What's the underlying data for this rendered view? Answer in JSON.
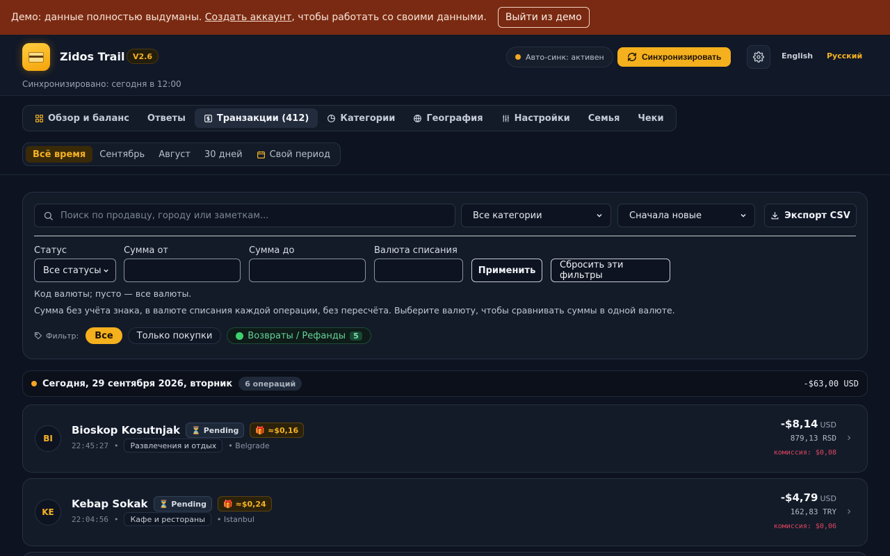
{
  "banner": {
    "text_before": "Демо: данные полностью выдуманы. ",
    "link": "Создать аккаунт",
    "text_after": ", чтобы работать со своими данными.",
    "exit_button": "Выйти из демо"
  },
  "header": {
    "app_name": "Zidos Trail",
    "version": "V2.6",
    "synced": "Синхронизировано: сегодня в 12:00",
    "autosync": "Авто-синк: активен",
    "sync_button": "Синхронизировать",
    "lang_en": "English",
    "lang_ru": "Русский",
    "accent_color": "#f5b01e"
  },
  "tabs": [
    {
      "label": "Обзор и баланс",
      "icon": "grid-icon"
    },
    {
      "label": "Ответы",
      "icon": ""
    },
    {
      "label": "Транзакции (412)",
      "icon": "dollar-icon",
      "active": true
    },
    {
      "label": "Категории",
      "icon": "pie-icon"
    },
    {
      "label": "География",
      "icon": "globe-icon"
    },
    {
      "label": "Настройки",
      "icon": "sliders-icon"
    },
    {
      "label": "Семья",
      "icon": ""
    },
    {
      "label": "Чеки",
      "icon": ""
    }
  ],
  "periods": [
    {
      "label": "Всё время",
      "active": true
    },
    {
      "label": "Сентябрь"
    },
    {
      "label": "Август"
    },
    {
      "label": "30 дней"
    },
    {
      "label": "Свой период",
      "icon": "calendar-icon"
    }
  ],
  "filters": {
    "search_placeholder": "Поиск по продавцу, городу или заметкам...",
    "category_select": "Все категории",
    "sort_select": "Сначала новые",
    "export": "Экспорт CSV",
    "status_label": "Статус",
    "status_value": "Все статусы",
    "amount_from_label": "Сумма от",
    "amount_to_label": "Сумма до",
    "currency_label": "Валюта списания",
    "apply": "Применить",
    "reset": "Сбросить эти фильтры",
    "hint_currency": "Код валюты; пусто — все валюты.",
    "hint_amount": "Сумма без учёта знака, в валюте списания каждой операции, без пересчёта. Выберите валюту, чтобы сравнивать суммы в одной валюте.",
    "filter_label": "Фильтр:",
    "chip_all": "Все",
    "chip_purchases": "Только покупки",
    "chip_refunds": "Возвраты / Рефанды",
    "chip_refunds_count": "5"
  },
  "day": {
    "title": "Сегодня, 29 сентября 2026, вторник",
    "count": "6 операций",
    "total": "-$63,00 USD"
  },
  "transactions": [
    {
      "initials": "BI",
      "merchant": "Bioskop Kosutnjak",
      "status": "Pending",
      "cashback": "≈$0,16",
      "time": "22:45:27",
      "category": "Развлечения и отдых",
      "city": "• Belgrade",
      "amount": "-$8,14",
      "currency": "USD",
      "original": "879,13 RSD",
      "fee": "комиссия: $0,08"
    },
    {
      "initials": "KE",
      "merchant": "Kebap Sokak",
      "status": "Pending",
      "cashback": "≈$0,24",
      "time": "22:04:56",
      "category": "Кафе и рестораны",
      "city": "• Istanbul",
      "amount": "-$4,79",
      "currency": "USD",
      "original": "162,83 TRY",
      "fee": "комиссия: $0,06"
    }
  ],
  "separator": "•"
}
